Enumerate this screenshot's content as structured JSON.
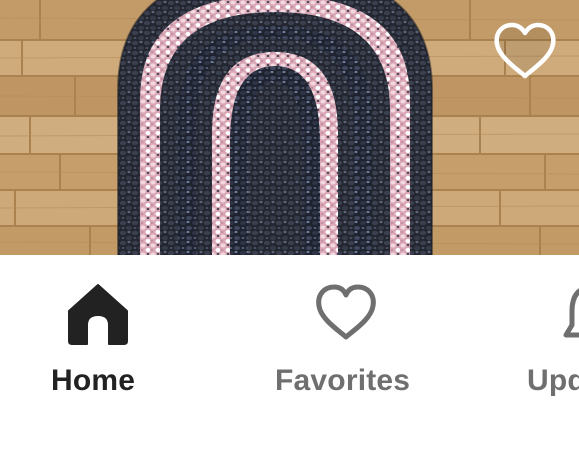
{
  "product_image": {
    "alt": "",
    "favorite_icon": "heart-outline-icon"
  },
  "tabbar": {
    "tabs": [
      {
        "label": "Home",
        "icon": "home-icon",
        "active": true
      },
      {
        "label": "Favorites",
        "icon": "heart-icon",
        "active": false
      },
      {
        "label": "Upd",
        "icon": "bell-icon",
        "active": false
      }
    ]
  },
  "colors": {
    "active_tab": "#222222",
    "inactive_tab": "#6f6f6f",
    "background": "#ffffff",
    "wood_floor": "#c8a270",
    "rug_dark": "#2a2e3a",
    "rug_pink": "#e8b8c4"
  }
}
